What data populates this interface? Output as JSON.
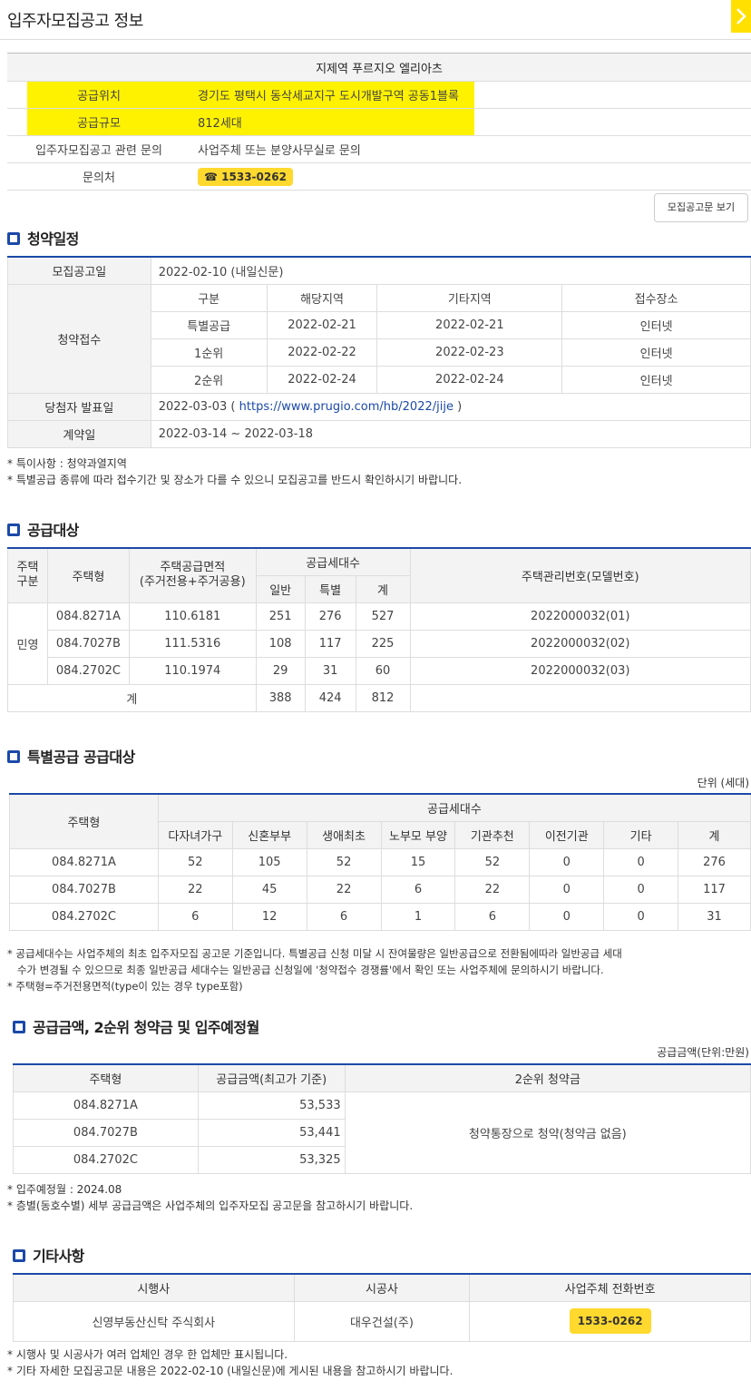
{
  "header": {
    "title": "입주자모집공고 정보"
  },
  "info": {
    "complex_name": "지제역 푸르지오 엘리아츠",
    "rows": [
      {
        "label": "공급위치",
        "value": "경기도 평택시 동삭세교지구 도시개발구역 공동1블록"
      },
      {
        "label": "공급규모",
        "value": "812세대"
      },
      {
        "label": "입주자모집공고 관련 문의",
        "value": "사업주체 또는 분양사무실로 문의"
      },
      {
        "label": "문의처",
        "value": "1533-0262"
      }
    ],
    "phone_icon": "☎",
    "highlight_color": "#fff200"
  },
  "notice_button": "모집공고문 보기",
  "schedule": {
    "title": "청약일정",
    "announce_label": "모집공고일",
    "announce_value": "2022-02-10 (내일신문)",
    "receipt_label": "청약접수",
    "cols": [
      "구분",
      "해당지역",
      "기타지역",
      "접수장소"
    ],
    "rows": [
      [
        "특별공급",
        "2022-02-21",
        "2022-02-21",
        "인터넷"
      ],
      [
        "1순위",
        "2022-02-22",
        "2022-02-23",
        "인터넷"
      ],
      [
        "2순위",
        "2022-02-24",
        "2022-02-24",
        "인터넷"
      ]
    ],
    "winner_label": "당첨자 발표일",
    "winner_date": "2022-03-03 (",
    "winner_link": "https://www.prugio.com/hb/2022/jije",
    "winner_close": ")",
    "contract_label": "계약일",
    "contract_value": "2022-03-14 ~ 2022-03-18",
    "notes": [
      "* 특이사항 : 청약과열지역",
      "* 특별공급 종류에 따라 접수기간 및 장소가 다를 수 있으니 모집공고를 반드시 확인하시기 바랍니다."
    ]
  },
  "supply": {
    "title": "공급대상",
    "h_gubun": "주택\n구분",
    "h_type": "주택형",
    "h_area": "주택공급면적\n(주거전용+주거공용)",
    "h_units": "공급세대수",
    "h_general": "일반",
    "h_special": "특별",
    "h_total": "계",
    "h_model": "주택관리번호(모델번호)",
    "gubun": "민영",
    "rows": [
      [
        "084.8271A",
        "110.6181",
        "251",
        "276",
        "527",
        "2022000032(01)"
      ],
      [
        "084.7027B",
        "111.5316",
        "108",
        "117",
        "225",
        "2022000032(02)"
      ],
      [
        "084.2702C",
        "110.1974",
        "29",
        "31",
        "60",
        "2022000032(03)"
      ]
    ],
    "total_label": "계",
    "totals": [
      "388",
      "424",
      "812"
    ]
  },
  "special": {
    "title": "특별공급 공급대상",
    "unit": "단위 (세대)",
    "h_type": "주택형",
    "h_units": "공급세대수",
    "cols": [
      "다자녀가구",
      "신혼부부",
      "생애최초",
      "노부모 부양",
      "기관추천",
      "이전기관",
      "기타",
      "계"
    ],
    "rows": [
      [
        "084.8271A",
        "52",
        "105",
        "52",
        "15",
        "52",
        "0",
        "0",
        "276"
      ],
      [
        "084.7027B",
        "22",
        "45",
        "22",
        "6",
        "22",
        "0",
        "0",
        "117"
      ],
      [
        "084.2702C",
        "6",
        "12",
        "6",
        "1",
        "6",
        "0",
        "0",
        "31"
      ]
    ],
    "notes": [
      "* 공급세대수는 사업주체의 최초 입주자모집 공고문 기준입니다. 특별공급 신청 미달 시 잔여물량은 일반공급으로 전환됨에따라 일반공급 세대",
      "   수가 변경될 수 있으므로 최종 일반공급 세대수는 일반공급 신청일에 '청약접수 경쟁률'에서 확인 또는 사업주체에 문의하시기 바랍니다.",
      "* 주택형=주거전용면적(type이 있는 경우 type포함)"
    ]
  },
  "price": {
    "title": "공급금액, 2순위 청약금 및 입주예정월",
    "unit": "공급금액(단위:만원)",
    "cols": [
      "주택형",
      "공급금액(최고가 기준)",
      "2순위 청약금"
    ],
    "rows": [
      [
        "084.8271A",
        "53,533"
      ],
      [
        "084.7027B",
        "53,441"
      ],
      [
        "084.2702C",
        "53,325"
      ]
    ],
    "deposit": "청약통장으로 청약(청약금 없음)",
    "notes": [
      "* 입주예정월 : 2024.08",
      "* 층별(동호수별) 세부 공급금액은 사업주체의 입주자모집 공고문을 참고하시기 바랍니다."
    ]
  },
  "etc": {
    "title": "기타사항",
    "cols": [
      "시행사",
      "시공사",
      "사업주체 전화번호"
    ],
    "developer": "신영부동산신탁 주식회사",
    "builder": "대우건설(주)",
    "phone": "1533-0262",
    "notes": [
      "* 시행사 및 시공사가 여러 업체인 경우 한 업체만 표시됩니다.",
      "* 기타 자세한 모집공고문 내용은 2022-02-10 (내일신문)에 게시된 내용을 참고하시기 바랍니다."
    ]
  }
}
